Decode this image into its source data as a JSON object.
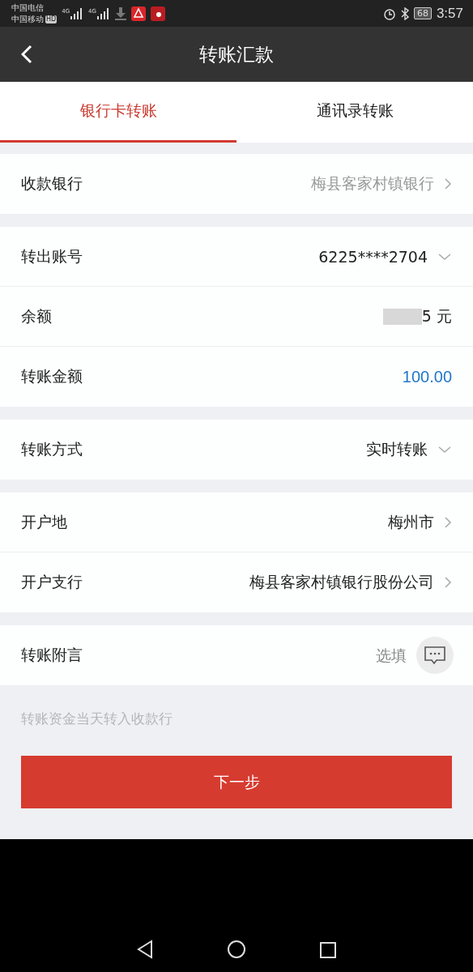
{
  "status_bar": {
    "carriers": [
      "中国电信",
      "中国移动"
    ],
    "hd_badge": "HD",
    "networks": [
      "4G",
      "4G"
    ],
    "battery": "68",
    "time": "3:57"
  },
  "header": {
    "back": true,
    "title": "转账汇款"
  },
  "tabs": [
    {
      "label": "银行卡转账",
      "selected": true
    },
    {
      "label": "通讯录转账",
      "selected": false
    }
  ],
  "groups": [
    {
      "rows": [
        {
          "kind": "link",
          "label": "收款银行",
          "value": "梅县客家村镇银行",
          "muted": true
        }
      ]
    },
    {
      "rows": [
        {
          "kind": "dropdown",
          "label": "转出账号",
          "value": "6225****2704",
          "muted": false
        },
        {
          "kind": "balance",
          "label": "余额",
          "value": "5 元",
          "muted": false
        },
        {
          "kind": "amount",
          "label": "转账金额",
          "value": "100.00"
        }
      ]
    },
    {
      "rows": [
        {
          "kind": "dropdown",
          "label": "转账方式",
          "value": "实时转账",
          "muted": false
        }
      ]
    },
    {
      "rows": [
        {
          "kind": "link",
          "label": "开户地",
          "value": "梅州市",
          "muted": false
        },
        {
          "kind": "link",
          "label": "开户支行",
          "value": "梅县客家村镇银行股份公司",
          "muted": false
        }
      ]
    },
    {
      "rows": [
        {
          "kind": "input",
          "label": "转账附言",
          "placeholder": "选填"
        }
      ]
    }
  ],
  "note": "转账资金当天转入收款行",
  "next_button": "下一步"
}
